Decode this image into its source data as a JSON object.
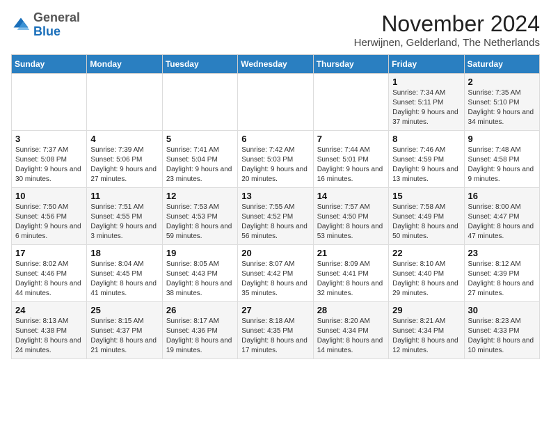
{
  "logo": {
    "general": "General",
    "blue": "Blue"
  },
  "header": {
    "month_title": "November 2024",
    "location": "Herwijnen, Gelderland, The Netherlands"
  },
  "weekdays": [
    "Sunday",
    "Monday",
    "Tuesday",
    "Wednesday",
    "Thursday",
    "Friday",
    "Saturday"
  ],
  "weeks": [
    [
      {
        "day": "",
        "info": ""
      },
      {
        "day": "",
        "info": ""
      },
      {
        "day": "",
        "info": ""
      },
      {
        "day": "",
        "info": ""
      },
      {
        "day": "",
        "info": ""
      },
      {
        "day": "1",
        "info": "Sunrise: 7:34 AM\nSunset: 5:11 PM\nDaylight: 9 hours and 37 minutes."
      },
      {
        "day": "2",
        "info": "Sunrise: 7:35 AM\nSunset: 5:10 PM\nDaylight: 9 hours and 34 minutes."
      }
    ],
    [
      {
        "day": "3",
        "info": "Sunrise: 7:37 AM\nSunset: 5:08 PM\nDaylight: 9 hours and 30 minutes."
      },
      {
        "day": "4",
        "info": "Sunrise: 7:39 AM\nSunset: 5:06 PM\nDaylight: 9 hours and 27 minutes."
      },
      {
        "day": "5",
        "info": "Sunrise: 7:41 AM\nSunset: 5:04 PM\nDaylight: 9 hours and 23 minutes."
      },
      {
        "day": "6",
        "info": "Sunrise: 7:42 AM\nSunset: 5:03 PM\nDaylight: 9 hours and 20 minutes."
      },
      {
        "day": "7",
        "info": "Sunrise: 7:44 AM\nSunset: 5:01 PM\nDaylight: 9 hours and 16 minutes."
      },
      {
        "day": "8",
        "info": "Sunrise: 7:46 AM\nSunset: 4:59 PM\nDaylight: 9 hours and 13 minutes."
      },
      {
        "day": "9",
        "info": "Sunrise: 7:48 AM\nSunset: 4:58 PM\nDaylight: 9 hours and 9 minutes."
      }
    ],
    [
      {
        "day": "10",
        "info": "Sunrise: 7:50 AM\nSunset: 4:56 PM\nDaylight: 9 hours and 6 minutes."
      },
      {
        "day": "11",
        "info": "Sunrise: 7:51 AM\nSunset: 4:55 PM\nDaylight: 9 hours and 3 minutes."
      },
      {
        "day": "12",
        "info": "Sunrise: 7:53 AM\nSunset: 4:53 PM\nDaylight: 8 hours and 59 minutes."
      },
      {
        "day": "13",
        "info": "Sunrise: 7:55 AM\nSunset: 4:52 PM\nDaylight: 8 hours and 56 minutes."
      },
      {
        "day": "14",
        "info": "Sunrise: 7:57 AM\nSunset: 4:50 PM\nDaylight: 8 hours and 53 minutes."
      },
      {
        "day": "15",
        "info": "Sunrise: 7:58 AM\nSunset: 4:49 PM\nDaylight: 8 hours and 50 minutes."
      },
      {
        "day": "16",
        "info": "Sunrise: 8:00 AM\nSunset: 4:47 PM\nDaylight: 8 hours and 47 minutes."
      }
    ],
    [
      {
        "day": "17",
        "info": "Sunrise: 8:02 AM\nSunset: 4:46 PM\nDaylight: 8 hours and 44 minutes."
      },
      {
        "day": "18",
        "info": "Sunrise: 8:04 AM\nSunset: 4:45 PM\nDaylight: 8 hours and 41 minutes."
      },
      {
        "day": "19",
        "info": "Sunrise: 8:05 AM\nSunset: 4:43 PM\nDaylight: 8 hours and 38 minutes."
      },
      {
        "day": "20",
        "info": "Sunrise: 8:07 AM\nSunset: 4:42 PM\nDaylight: 8 hours and 35 minutes."
      },
      {
        "day": "21",
        "info": "Sunrise: 8:09 AM\nSunset: 4:41 PM\nDaylight: 8 hours and 32 minutes."
      },
      {
        "day": "22",
        "info": "Sunrise: 8:10 AM\nSunset: 4:40 PM\nDaylight: 8 hours and 29 minutes."
      },
      {
        "day": "23",
        "info": "Sunrise: 8:12 AM\nSunset: 4:39 PM\nDaylight: 8 hours and 27 minutes."
      }
    ],
    [
      {
        "day": "24",
        "info": "Sunrise: 8:13 AM\nSunset: 4:38 PM\nDaylight: 8 hours and 24 minutes."
      },
      {
        "day": "25",
        "info": "Sunrise: 8:15 AM\nSunset: 4:37 PM\nDaylight: 8 hours and 21 minutes."
      },
      {
        "day": "26",
        "info": "Sunrise: 8:17 AM\nSunset: 4:36 PM\nDaylight: 8 hours and 19 minutes."
      },
      {
        "day": "27",
        "info": "Sunrise: 8:18 AM\nSunset: 4:35 PM\nDaylight: 8 hours and 17 minutes."
      },
      {
        "day": "28",
        "info": "Sunrise: 8:20 AM\nSunset: 4:34 PM\nDaylight: 8 hours and 14 minutes."
      },
      {
        "day": "29",
        "info": "Sunrise: 8:21 AM\nSunset: 4:34 PM\nDaylight: 8 hours and 12 minutes."
      },
      {
        "day": "30",
        "info": "Sunrise: 8:23 AM\nSunset: 4:33 PM\nDaylight: 8 hours and 10 minutes."
      }
    ]
  ]
}
